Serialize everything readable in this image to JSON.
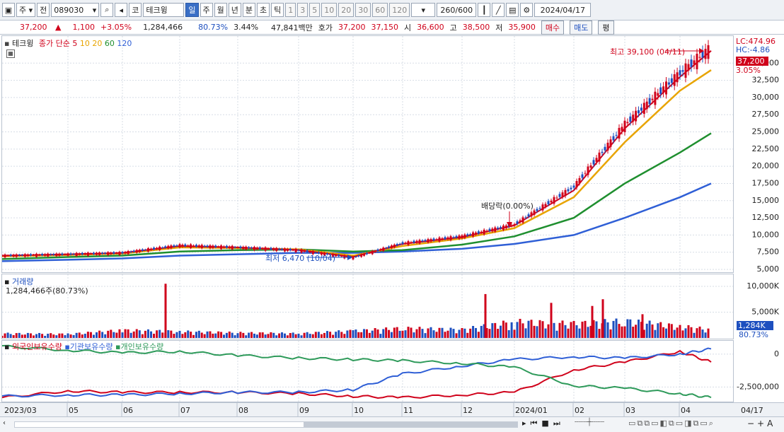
{
  "toolbar": {
    "market": "주",
    "prev": "전",
    "code": "089030",
    "exchange": "코",
    "name": "테크윙",
    "periods": [
      "일",
      "주",
      "월",
      "년",
      "분",
      "초",
      "틱"
    ],
    "active_period": "일",
    "intervals": [
      "1",
      "3",
      "5",
      "10",
      "20",
      "30",
      "60",
      "120"
    ],
    "count": "260",
    "count_max": "/600",
    "date": "2024/04/17"
  },
  "quote": {
    "price": "37,200",
    "arrow": "▲",
    "change": "1,100",
    "change_pct": "+3.05%",
    "volume": "1,284,466",
    "vol_ratio": "80.73%",
    "turnover": "3.44%",
    "amount": "47,841백만",
    "ask_label": "호가",
    "ask": "37,200",
    "bid": "37,150",
    "open_label": "시",
    "open": "36,600",
    "high_label": "고",
    "high": "38,500",
    "low_label": "저",
    "low": "35,900",
    "buy": "매수",
    "sell": "매도",
    "eval": "평"
  },
  "price_legend": {
    "name": "테크윙",
    "close_label": "종가",
    "ma_type": "단순",
    "ma": [
      "5",
      "10",
      "20",
      "60",
      "120"
    ]
  },
  "volume_legend": {
    "title": "거래량",
    "value": "1,284,466주(80.73%)"
  },
  "holdings_legend": {
    "foreign": "외국인보유수량",
    "institution": "기관보유수량",
    "individual": "개인보유수량"
  },
  "annotations": {
    "high": "최고 39,100 (04/11)",
    "low": "최저 6,470 (10/04)",
    "dividend": "배당락(0.00%)"
  },
  "right_scale": {
    "lc": "LC:474.96",
    "hc": "HC:-4.86",
    "price_tag": "37,200",
    "pct_tag": "3.05%",
    "price_ticks": [
      "35,000",
      "32,500",
      "30,000",
      "27,500",
      "25,000",
      "22,500",
      "20,000",
      "17,500",
      "15,000",
      "12,500",
      "10,000",
      "7,500",
      "5,000"
    ],
    "vol_ticks": [
      "10,000K",
      "5,000K"
    ],
    "vol_tag": "1,284K",
    "vol_pct": "80.73%",
    "hold_ticks": [
      "0",
      "-2,500,000"
    ]
  },
  "x_labels": [
    "2023/03",
    "05",
    "06",
    "07",
    "08",
    "09",
    "10",
    "11",
    "12",
    "2024/01",
    "02",
    "03",
    "04",
    "04/17"
  ],
  "colors": {
    "up": "#d0021b",
    "down": "#1d4fbf",
    "ma5": "#d0021b",
    "ma10": "#e8a400",
    "ma20": "#e8a400",
    "ma60": "#1f8f2f",
    "ma120": "#2f5fd6",
    "foreign": "#d0021b",
    "institution": "#2f5fd6",
    "individual": "#2e9a5a"
  },
  "chart_data": [
    {
      "type": "line",
      "title": "테크윙 종가 단순 이동평균",
      "x": [
        "2023/03",
        "05",
        "06",
        "07",
        "08",
        "09",
        "10",
        "11",
        "12",
        "2024/01",
        "02",
        "03",
        "04",
        "04/17"
      ],
      "ylim": [
        5000,
        37500
      ],
      "series": [
        {
          "name": "종가",
          "values": [
            7000,
            7200,
            7400,
            8500,
            8200,
            7800,
            6700,
            8800,
            9800,
            11500,
            17000,
            26000,
            33500,
            37200
          ]
        },
        {
          "name": "5",
          "values": [
            7000,
            7200,
            7400,
            8400,
            8200,
            7800,
            6800,
            8700,
            9700,
            11400,
            16500,
            25500,
            33000,
            36800
          ]
        },
        {
          "name": "20",
          "values": [
            6900,
            7100,
            7300,
            8200,
            8100,
            7900,
            7000,
            8400,
            9500,
            11000,
            15500,
            23500,
            31000,
            34000
          ]
        },
        {
          "name": "60",
          "values": [
            6500,
            6800,
            7000,
            7600,
            7800,
            7900,
            7600,
            7800,
            8600,
            9800,
            12500,
            17500,
            22000,
            24800
          ]
        },
        {
          "name": "120",
          "values": [
            6200,
            6400,
            6600,
            7000,
            7200,
            7400,
            7400,
            7600,
            8000,
            8700,
            10000,
            12500,
            15500,
            17500
          ]
        }
      ]
    },
    {
      "type": "bar",
      "title": "거래량",
      "categories": [
        "2023/03",
        "05",
        "06",
        "07",
        "08",
        "09",
        "10",
        "11",
        "12",
        "2024/01",
        "02",
        "03",
        "04",
        "04/17"
      ],
      "values": [
        700,
        600,
        1200,
        1000,
        800,
        700,
        1100,
        1500,
        1300,
        2500,
        2200,
        2600,
        1800,
        1284
      ],
      "ylim": [
        0,
        11500
      ]
    },
    {
      "type": "line",
      "title": "보유수량",
      "x": [
        "2023/03",
        "05",
        "06",
        "07",
        "08",
        "09",
        "10",
        "11",
        "12",
        "2024/01",
        "02",
        "03",
        "04",
        "04/17"
      ],
      "ylim": [
        -3500000,
        800000
      ],
      "series": [
        {
          "name": "외국인보유수량",
          "values": [
            -3300000,
            -2800000,
            -2900000,
            -2900000,
            -2900000,
            -3000000,
            -3200000,
            -3300000,
            -3100000,
            -2900000,
            -1200000,
            -600000,
            200000,
            -600000
          ]
        },
        {
          "name": "기관보유수량",
          "values": [
            -3200000,
            -3100000,
            -3100000,
            -3000000,
            -2900000,
            -2900000,
            -2700000,
            -1500000,
            -900000,
            -400000,
            -200000,
            -300000,
            0,
            400000
          ]
        },
        {
          "name": "개인보유수량",
          "values": [
            600000,
            300000,
            100000,
            200000,
            -100000,
            -300000,
            -400000,
            -500000,
            -700000,
            -1000000,
            -2400000,
            -2600000,
            -3000000,
            -3300000
          ]
        }
      ]
    }
  ]
}
